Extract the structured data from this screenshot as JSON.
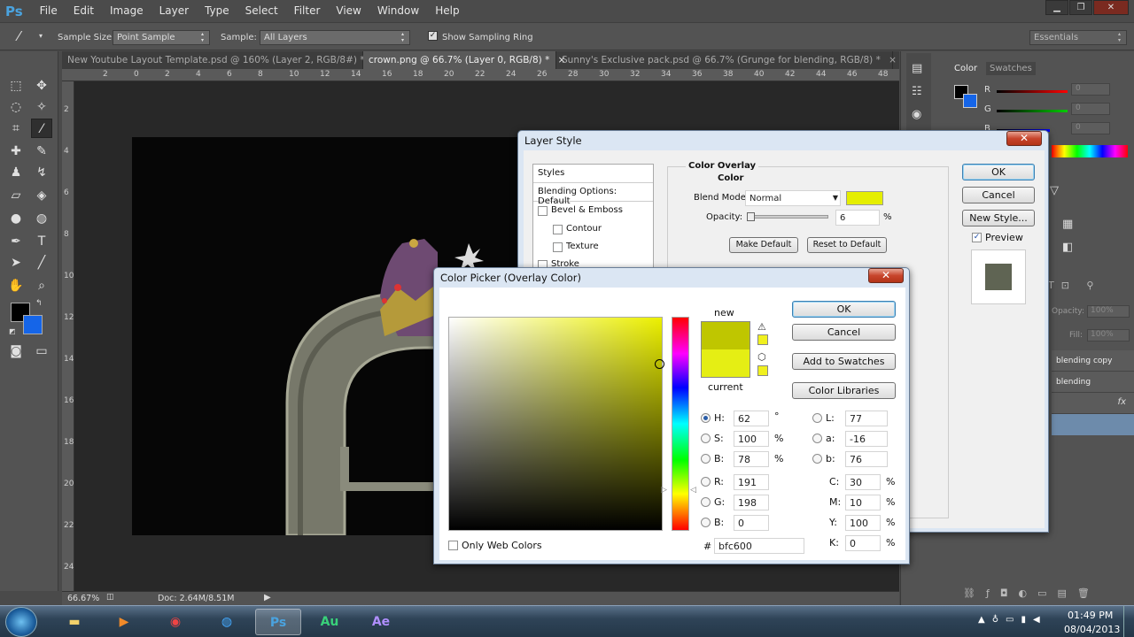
{
  "app": {
    "logo": "Ps"
  },
  "menu": [
    "File",
    "Edit",
    "Image",
    "Layer",
    "Type",
    "Select",
    "Filter",
    "View",
    "Window",
    "Help"
  ],
  "window_controls": {
    "minimize": "▁",
    "restore": "❐",
    "close": "✕"
  },
  "options_bar": {
    "sample_size_label": "Sample Size:",
    "sample_size_value": "Point Sample",
    "sample_label": "Sample:",
    "sample_value": "All Layers",
    "ring_label": "Show Sampling Ring",
    "workspace": "Essentials"
  },
  "tabs": [
    {
      "label": "New Youtube Layout Template.psd @ 160% (Layer 2, RGB/8#) *"
    },
    {
      "label": "crown.png @ 66.7% (Layer 0, RGB/8) *"
    },
    {
      "label": "Sunny's Exclusive pack.psd @ 66.7% (Grunge for blending, RGB/8) *"
    }
  ],
  "tab_close": "×",
  "ruler": {
    "top": [
      "2",
      "0",
      "2",
      "4",
      "6",
      "8",
      "10",
      "12",
      "14",
      "16",
      "18",
      "20",
      "22",
      "24",
      "26",
      "28",
      "30",
      "32",
      "34",
      "36",
      "38",
      "40",
      "42",
      "44",
      "46",
      "48"
    ],
    "left": [
      "2",
      "4",
      "6",
      "8",
      "10",
      "12",
      "14",
      "16",
      "18",
      "20",
      "22",
      "24"
    ]
  },
  "status": {
    "zoom": "66.67%",
    "doc": "Doc: 2.64M/8.51M"
  },
  "right_panel": {
    "color_tab": "Color",
    "swatches_tab": "Swatches",
    "channels": [
      "R",
      "G",
      "B"
    ],
    "channel_values": [
      "0",
      "0",
      "0"
    ],
    "opacity_label": "Opacity:",
    "opacity_value": "100%",
    "fill_label": "Fill:",
    "fill_value": "100%",
    "layers": [
      "blending copy",
      "blending"
    ],
    "fx": "fx"
  },
  "layer_style": {
    "title": "Layer Style",
    "sidebar": [
      "Styles",
      "Blending Options: Default",
      "Bevel & Emboss",
      "Contour",
      "Texture",
      "Stroke"
    ],
    "section_title": "Color Overlay",
    "section_subtitle": "Color",
    "blend_mode_label": "Blend Mode:",
    "blend_mode_value": "Normal",
    "opacity_label": "Opacity:",
    "opacity_value": "6",
    "opacity_unit": "%",
    "make_default": "Make Default",
    "reset_default": "Reset to Default",
    "ok": "OK",
    "cancel": "Cancel",
    "new_style": "New Style...",
    "preview": "Preview",
    "overlay_color": "#e5ee00",
    "preview_color": "#5f6453"
  },
  "color_picker": {
    "title": "Color Picker (Overlay Color)",
    "new_label": "new",
    "current_label": "current",
    "new_color": "#bfc600",
    "current_color": "#e5ee14",
    "ok": "OK",
    "cancel": "Cancel",
    "add_swatches": "Add to Swatches",
    "libraries": "Color Libraries",
    "fields": {
      "H": {
        "label": "H:",
        "value": "62",
        "unit": "°"
      },
      "S": {
        "label": "S:",
        "value": "100",
        "unit": "%"
      },
      "Bv": {
        "label": "B:",
        "value": "78",
        "unit": "%"
      },
      "R": {
        "label": "R:",
        "value": "191"
      },
      "G": {
        "label": "G:",
        "value": "198"
      },
      "Bc": {
        "label": "B:",
        "value": "0"
      },
      "L": {
        "label": "L:",
        "value": "77"
      },
      "a": {
        "label": "a:",
        "value": "-16"
      },
      "b": {
        "label": "b:",
        "value": "76"
      },
      "C": {
        "label": "C:",
        "value": "30",
        "unit": "%"
      },
      "M": {
        "label": "M:",
        "value": "10",
        "unit": "%"
      },
      "Y": {
        "label": "Y:",
        "value": "100",
        "unit": "%"
      },
      "K": {
        "label": "K:",
        "value": "0",
        "unit": "%"
      }
    },
    "hex_label": "#",
    "hex_value": "bfc600",
    "only_web": "Only Web Colors",
    "field_hue_color": "#ecf000"
  },
  "taskbar": {
    "apps": [
      {
        "name": "Ps",
        "color": "#4aa3df"
      },
      {
        "name": "Au",
        "color": "#39d17a"
      },
      {
        "name": "Ae",
        "color": "#b08fff"
      }
    ],
    "time": "01:49 PM",
    "date": "08/04/2013"
  }
}
